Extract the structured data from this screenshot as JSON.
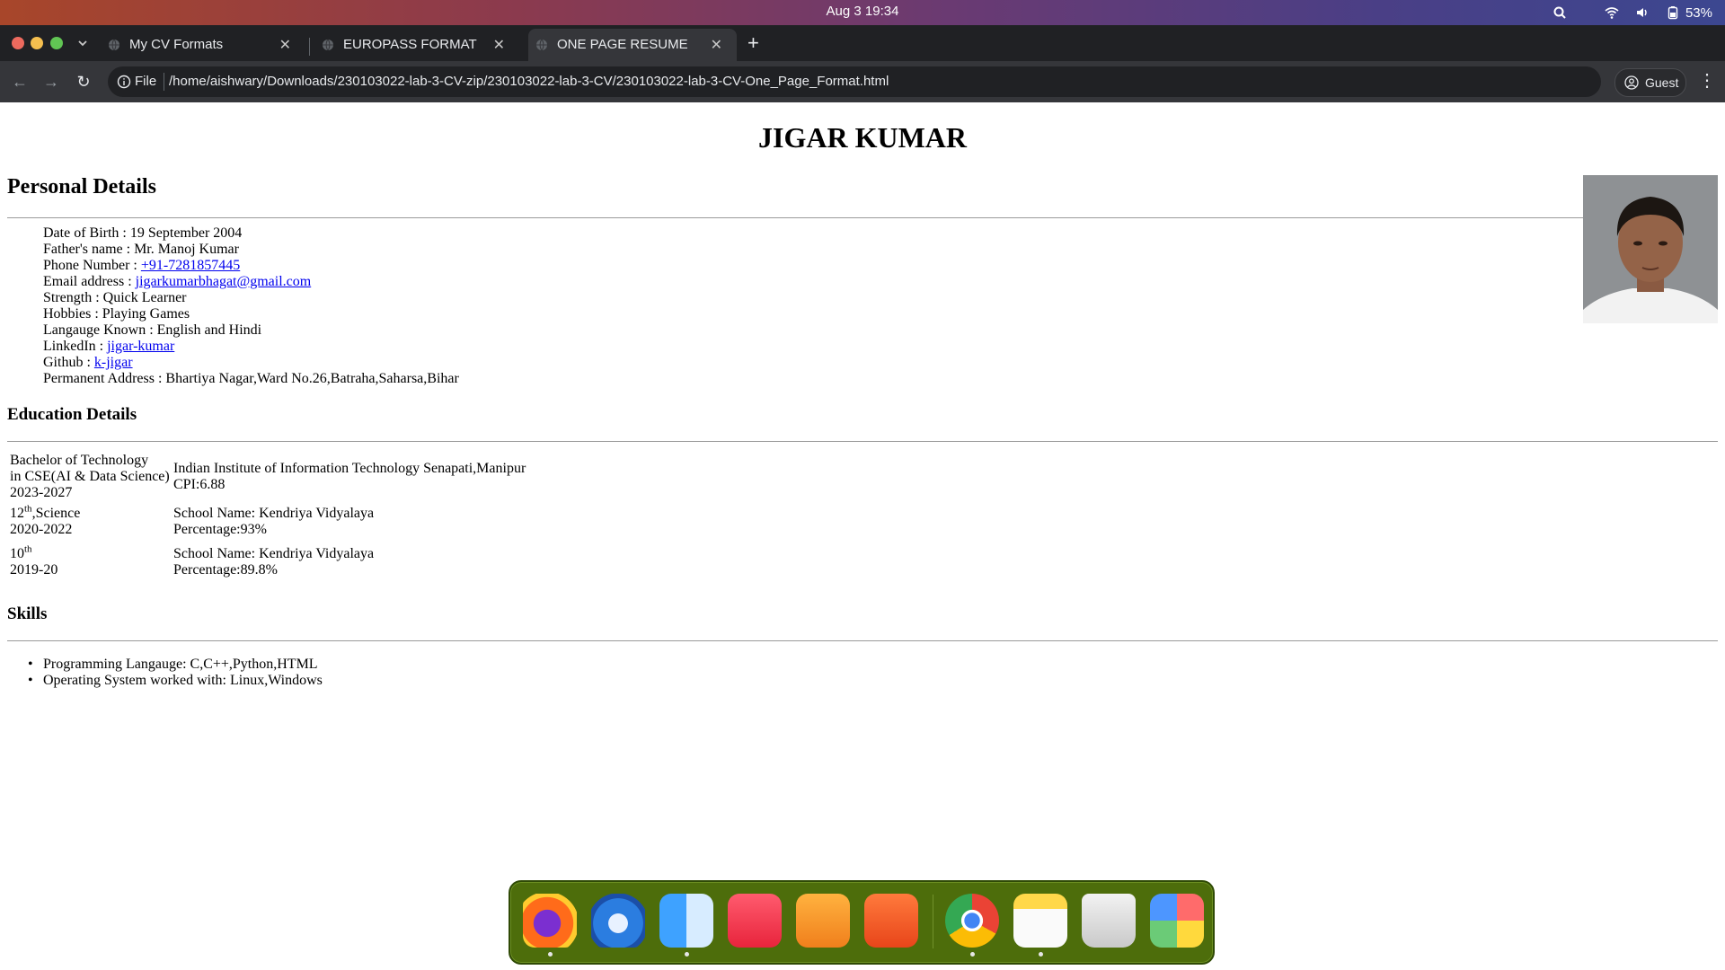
{
  "system_bar": {
    "datetime": "Aug 3  19:34",
    "battery": "53%"
  },
  "tabs": [
    {
      "title": "My CV Formats",
      "active": false
    },
    {
      "title": "EUROPASS FORMAT",
      "active": false
    },
    {
      "title": "ONE PAGE RESUME",
      "active": true
    }
  ],
  "toolbar": {
    "scheme_label": "File",
    "url": "/home/aishwary/Downloads/230103022-lab-3-CV-zip/230103022-lab-3-CV/230103022-lab-3-CV-One_Page_Format.html",
    "profile_label": "Guest"
  },
  "resume": {
    "name": "JIGAR KUMAR",
    "personal_heading": "Personal Details",
    "personal": {
      "dob_label": "Date of Birth : ",
      "dob": "19 September 2004",
      "father_label": "Father's name : ",
      "father": "Mr. Manoj Kumar",
      "phone_label": "Phone Number : ",
      "phone": "+91-7281857445",
      "email_label": "Email address : ",
      "email": "jigarkumarbhagat@gmail.com",
      "strength_label": "Strength : ",
      "strength": "Quick Learner",
      "hobbies_label": "Hobbies : ",
      "hobbies": "Playing Games",
      "languages_label": "Langauge Known : ",
      "languages": "English and Hindi",
      "linkedin_label": "LinkedIn : ",
      "linkedin": "jigar-kumar",
      "github_label": "Github : ",
      "github": "k-jigar",
      "address_label": "Permanent Address : ",
      "address": "Bhartiya Nagar,Ward No.26,Batraha,Saharsa,Bihar"
    },
    "education_heading": "Education Details",
    "education": [
      {
        "line1": "Bachelor of Technology",
        "line2": "in CSE(AI & Data Science)",
        "years": "2023-2027",
        "inst": "Indian Institute of Information Technology Senapati,Manipur",
        "score": "CPI:6.88"
      },
      {
        "grade": "12",
        "grade_sup": "th",
        "grade_suffix": ",Science",
        "years": "2020-2022",
        "inst": "School Name: Kendriya Vidyalaya",
        "score": "Percentage:93%"
      },
      {
        "grade": "10",
        "grade_sup": "th",
        "grade_suffix": "",
        "years": "2019-20",
        "inst": "School Name: Kendriya Vidyalaya",
        "score": "Percentage:89.8%"
      }
    ],
    "skills_heading": "Skills",
    "skills": [
      "Programming Langauge: C,C++,Python,HTML",
      "Operating System worked with: Linux,Windows"
    ]
  },
  "dock": {
    "apps": [
      "firefox-icon",
      "thunderbird-icon",
      "finder-icon",
      "music-icon",
      "pages-icon",
      "app-store-icon",
      "chrome-icon",
      "notes-icon",
      "trash-icon",
      "launchpad-icon"
    ]
  }
}
